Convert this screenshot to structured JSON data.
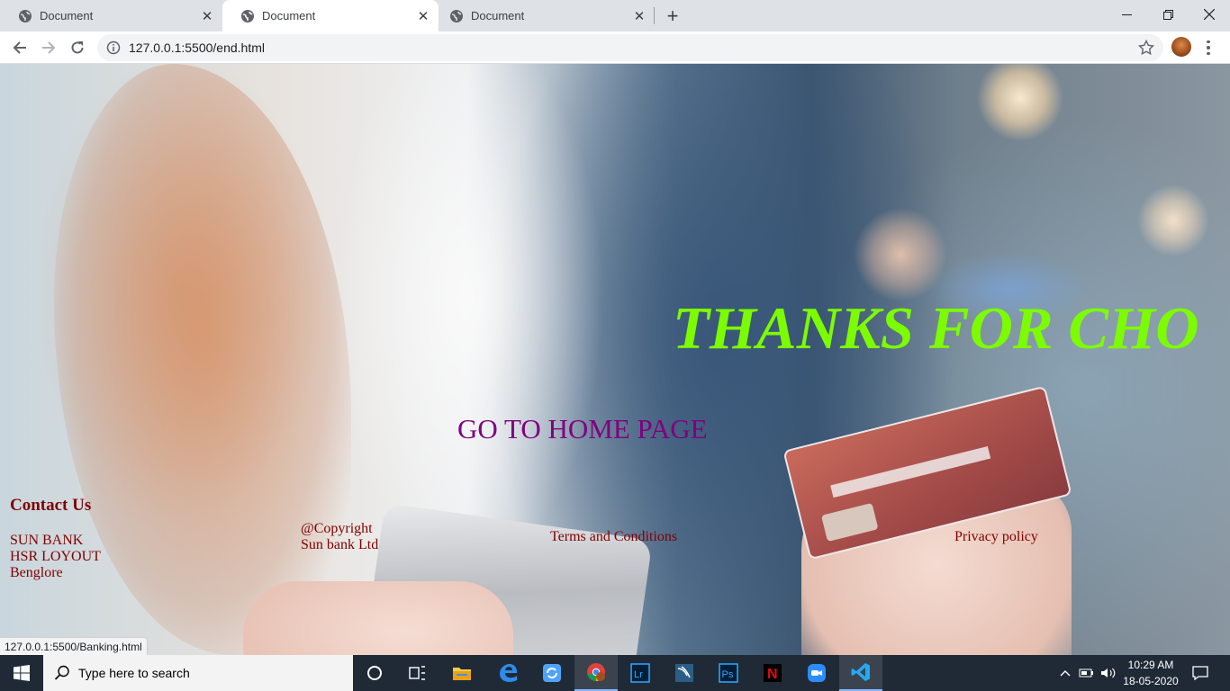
{
  "browser": {
    "tabs": [
      {
        "title": "Document",
        "active": false
      },
      {
        "title": "Document",
        "active": true
      },
      {
        "title": "Document",
        "active": false
      }
    ],
    "url": "127.0.0.1:5500/end.html",
    "status_url": "127.0.0.1:5500/Banking.html",
    "icons": {
      "tab_favicon": "globe-icon",
      "tab_close": "close-icon",
      "new_tab": "plus-icon",
      "minimize": "minimize-icon",
      "restore": "restore-icon",
      "close_window": "close-icon",
      "back": "arrow-left-icon",
      "forward": "arrow-right-icon",
      "reload": "reload-icon",
      "site_info": "info-icon",
      "bookmark": "star-icon",
      "menu": "kebab-menu-icon"
    }
  },
  "page": {
    "headline": "THANKS FOR CHO",
    "home_link": "GO TO HOME PAGE",
    "footer": {
      "contact_title": "Contact Us",
      "contact_lines": [
        "SUN BANK",
        "HSR LOYOUT",
        "Benglore"
      ],
      "copyright_lines": [
        "@Copyright",
        "Sun bank Ltd"
      ],
      "terms": "Terms and Conditions",
      "privacy": "Privacy policy"
    },
    "colors": {
      "headline": "#7cfc00",
      "link": "#800080",
      "footer_text": "#800000"
    }
  },
  "taskbar": {
    "search_placeholder": "Type here to search",
    "pinned_apps": [
      "cortana-icon",
      "task-view-icon",
      "file-explorer-icon",
      "edge-icon",
      "sync-app-icon",
      "chrome-icon",
      "lightroom-icon",
      "mysql-workbench-icon",
      "photoshop-icon",
      "netflix-icon",
      "zoom-icon",
      "vscode-icon"
    ],
    "pinned_labels": {
      "lightroom": "Lr",
      "photoshop": "Ps",
      "netflix": "N"
    },
    "time": "10:29 AM",
    "date": "18-05-2020"
  }
}
